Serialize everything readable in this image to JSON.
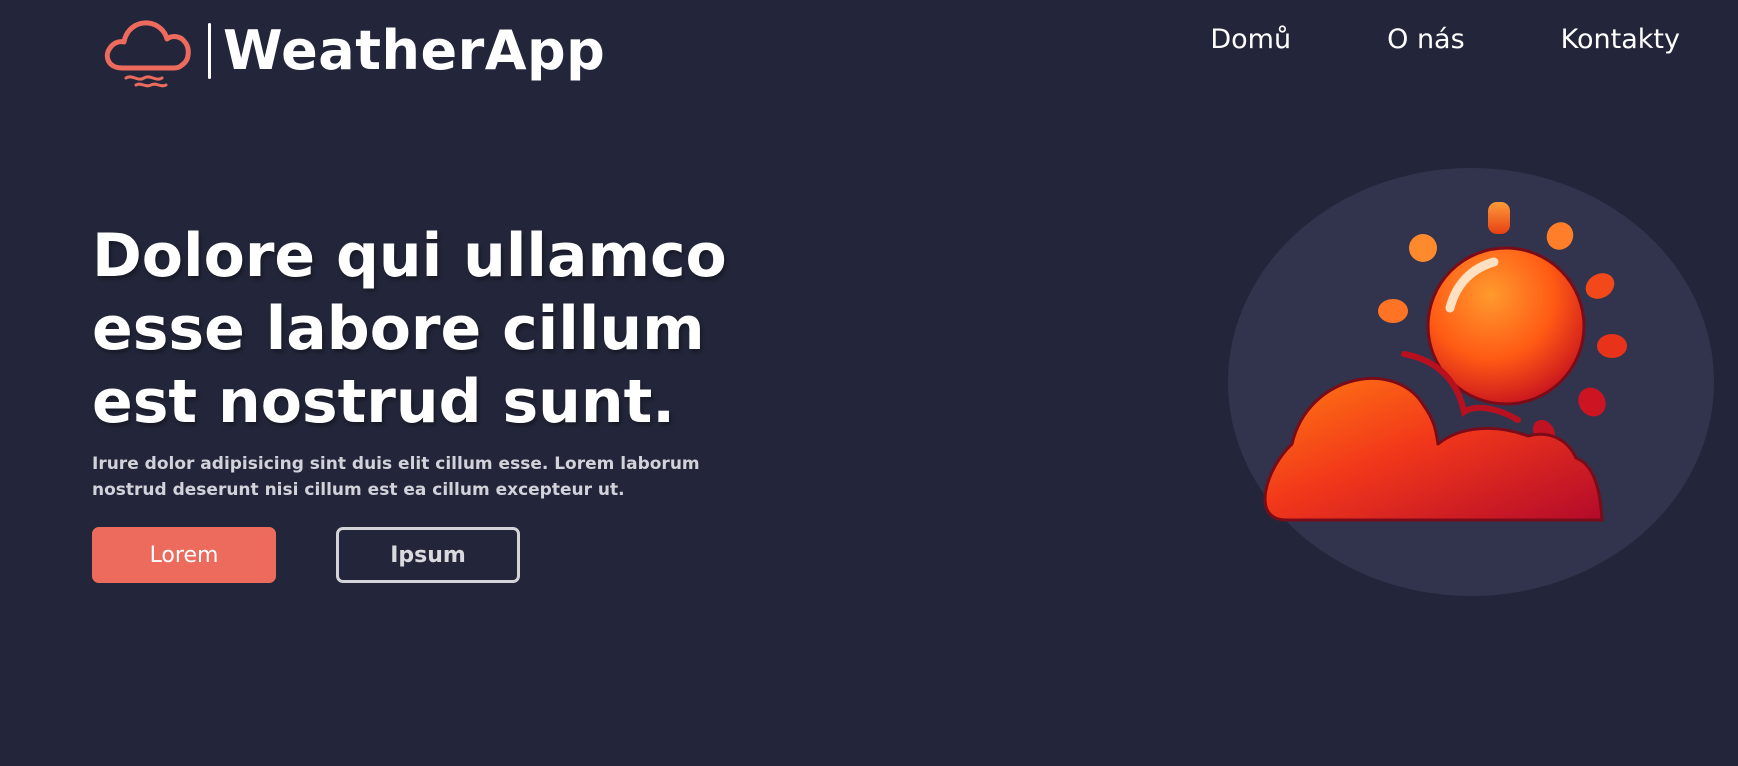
{
  "app": {
    "brand_name": "WeatherApp",
    "accent_color": "#ec6b5d",
    "background_color": "#23263a"
  },
  "nav": {
    "items": [
      {
        "label": "Domů"
      },
      {
        "label": "O nás"
      },
      {
        "label": "Kontakty"
      }
    ]
  },
  "hero": {
    "title_lines": [
      "Dolore qui ullamco",
      "esse labore cillum",
      "est nostrud sunt."
    ],
    "subtitle_lines": [
      "Irure dolor adipisicing sint duis elit cillum esse. Lorem laborum",
      "nostrud deserunt nisi cillum est ea cillum excepteur ut."
    ],
    "primary_button": "Lorem",
    "secondary_button": "Ipsum"
  },
  "illustration": {
    "icon": "sun-behind-cloud-icon"
  }
}
